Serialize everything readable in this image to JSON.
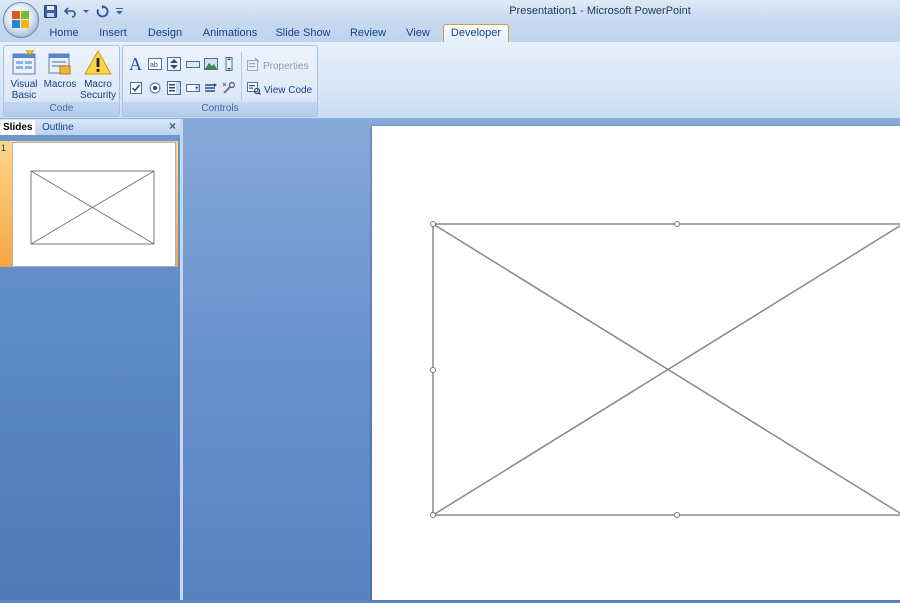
{
  "window": {
    "title": "Presentation1 - Microsoft PowerPoint"
  },
  "quick_access_toolbar": {
    "icons": [
      "save-icon",
      "undo-icon",
      "redo-icon",
      "customize-dropdown-icon"
    ]
  },
  "ribbon_tabs": [
    {
      "label": "Home"
    },
    {
      "label": "Insert"
    },
    {
      "label": "Design"
    },
    {
      "label": "Animations"
    },
    {
      "label": "Slide Show"
    },
    {
      "label": "Review"
    },
    {
      "label": "View"
    },
    {
      "label": "Developer",
      "active": true
    }
  ],
  "ribbon": {
    "code_group": {
      "label": "Code",
      "visual_basic_line1": "Visual",
      "visual_basic_line2": "Basic",
      "macros": "Macros",
      "macro_security_line1": "Macro",
      "macro_security_line2": "Security"
    },
    "controls_group": {
      "label": "Controls",
      "properties": "Properties",
      "view_code": "View Code"
    }
  },
  "slides_pane": {
    "tab_slides": "Slides",
    "tab_outline": "Outline",
    "close_glyph": "×",
    "thumbnails": [
      {
        "number": "1"
      }
    ]
  },
  "colors": {
    "accent_orange": "#f5a743",
    "ribbon_text": "#15428b",
    "workspace_blue": "#6b93cd"
  }
}
